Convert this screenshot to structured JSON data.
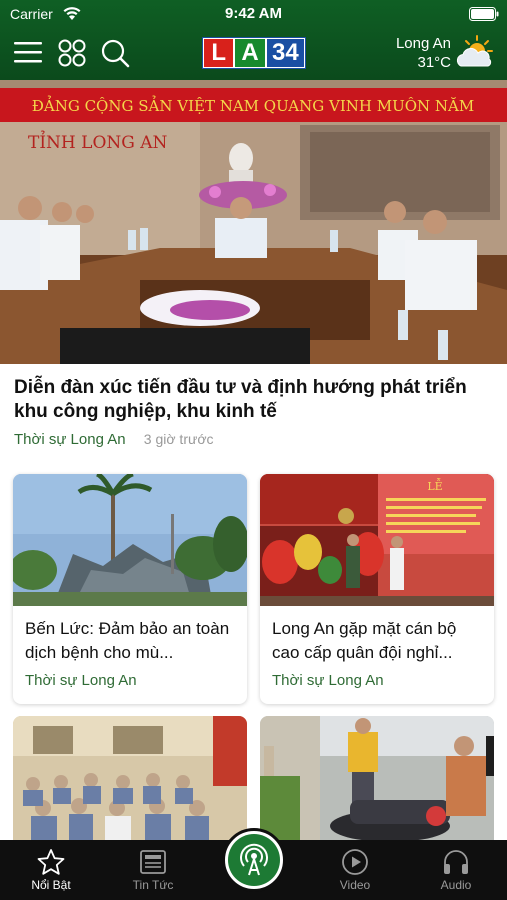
{
  "status_bar": {
    "carrier": "Carrier",
    "time": "9:42 AM"
  },
  "header": {
    "logo": {
      "l": "L",
      "a": "A",
      "num": "34"
    },
    "weather": {
      "city": "Long An",
      "temp": "31°C",
      "icon": "partly-cloudy-sun-icon"
    },
    "icons": [
      "hamburger-menu-icon",
      "grid-icon",
      "search-icon"
    ]
  },
  "hero": {
    "banner_text": "ĐẢNG CỘNG SẢN VIỆT NAM QUANG VINH MUÔN NĂM",
    "sign_text": "TỈNH LONG AN",
    "title": "Diễn đàn xúc tiến đầu tư và định hướng phát triển khu công nghiệp, khu kinh tế",
    "category": "Thời sự Long An",
    "time": "3 giờ trước"
  },
  "cards": [
    {
      "title": "Bến Lức: Đảm bảo an toàn dịch bệnh cho mù...",
      "category": "Thời sự Long An"
    },
    {
      "title": "Long An gặp mặt cán bộ cao cấp quân đội nghỉ...",
      "category": "Thời sự Long An",
      "banner_text": "LỄ"
    }
  ],
  "tabbar": {
    "items": [
      {
        "label": "Nổi Bật",
        "icon": "star-icon",
        "active": true
      },
      {
        "label": "Tin Tức",
        "icon": "newspaper-icon",
        "active": false
      },
      {
        "label": "",
        "icon": "broadcast-icon",
        "active": false
      },
      {
        "label": "Video",
        "icon": "play-circle-icon",
        "active": false
      },
      {
        "label": "Audio",
        "icon": "headphones-icon",
        "active": false
      }
    ]
  },
  "colors": {
    "header_green": "#0f5f24",
    "category_green": "#2f6b35",
    "tabbar_bg": "#0f0f0f"
  }
}
